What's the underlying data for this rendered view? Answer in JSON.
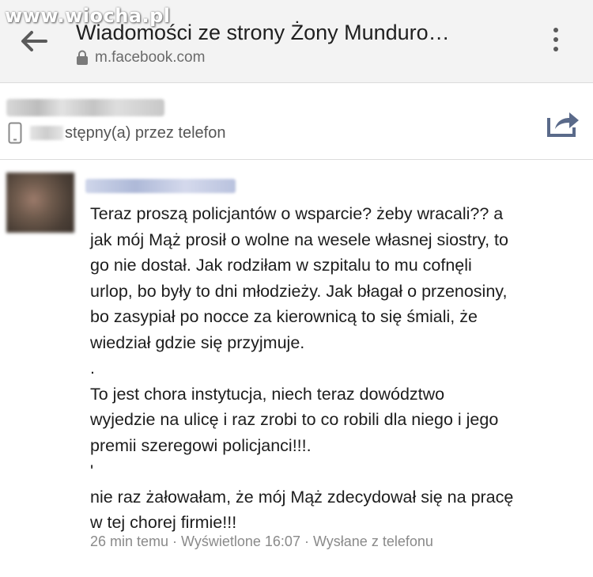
{
  "watermark": "www.wiocha.pl",
  "topbar": {
    "title": "Wiadomości ze strony Żony Munduro…",
    "url": "m.facebook.com",
    "back_icon": "arrow-left-icon",
    "menu_icon": "more-vert-icon",
    "lock_icon": "lock-icon"
  },
  "header": {
    "status_text": "stępny(a) przez telefon",
    "phone_icon": "phone-icon",
    "share_icon": "share-icon"
  },
  "message": {
    "lines": [
      "Teraz proszą policjantów o wsparcie? żeby wracali?? a",
      "jak mój Mąż prosił o wolne na wesele własnej siostry, to",
      "go nie dostał. Jak rodziłam w szpitalu to mu cofnęli",
      "urlop, bo były to dni młodzieży. Jak błagał o przenosiny,",
      "bo zasypiał po nocce za kierownicą to się śmiali, że",
      "wiedział gdzie się przyjmuje.",
      ".",
      "To jest chora instytucja, niech teraz dowództwo",
      "wyjedzie na ulicę i raz zrobi to co robili dla niego i jego",
      "premii szeregowi policjanci!!!.",
      "'",
      "nie raz żałowałam, że mój Mąż zdecydował się na pracę",
      "w tej chorej firmie!!!"
    ],
    "meta": "26 min temu · Wyświetlone 16:07 · Wysłane z telefonu"
  },
  "colors": {
    "topbar_bg": "#f3f3f3",
    "text": "#1d1d1d",
    "muted": "#8a8a8a",
    "icon": "#5a6a8a"
  }
}
